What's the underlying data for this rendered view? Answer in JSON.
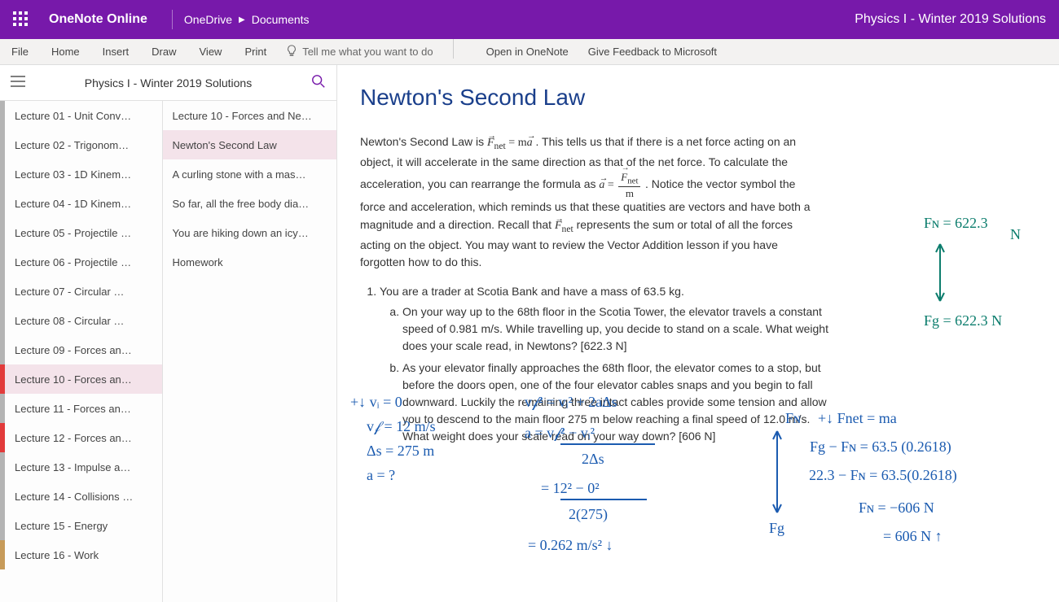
{
  "header": {
    "app_name": "OneNote Online",
    "breadcrumb_root": "OneDrive",
    "breadcrumb_folder": "Documents",
    "doc_title": "Physics I - Winter 2019 Solutions"
  },
  "ribbon": {
    "tabs": [
      "File",
      "Home",
      "Insert",
      "Draw",
      "View",
      "Print"
    ],
    "tell_me": "Tell me what you want to do",
    "open_in": "Open in OneNote",
    "feedback": "Give Feedback to Microsoft"
  },
  "nav": {
    "title": "Physics I - Winter 2019 Solutions",
    "sections": [
      {
        "label": "Lecture 01 - Unit Conv…",
        "color": "#b4b4b4"
      },
      {
        "label": "Lecture 02 - Trigonom…",
        "color": "#b4b4b4"
      },
      {
        "label": "Lecture 03 - 1D Kinem…",
        "color": "#b4b4b4"
      },
      {
        "label": "Lecture 04 - 1D Kinem…",
        "color": "#b4b4b4"
      },
      {
        "label": "Lecture 05 - Projectile …",
        "color": "#b4b4b4"
      },
      {
        "label": "Lecture 06 - Projectile …",
        "color": "#b4b4b4"
      },
      {
        "label": "Lecture 07 - Circular …",
        "color": "#b4b4b4"
      },
      {
        "label": "Lecture 08 - Circular …",
        "color": "#b4b4b4"
      },
      {
        "label": "Lecture 09 - Forces an…",
        "color": "#b4b4b4"
      },
      {
        "label": "Lecture 10 - Forces an…",
        "color": "#e23b3b",
        "selected": true
      },
      {
        "label": "Lecture 11 - Forces an…",
        "color": "#b4b4b4"
      },
      {
        "label": "Lecture 12 - Forces an…",
        "color": "#e23b3b"
      },
      {
        "label": "Lecture 13 - Impulse a…",
        "color": "#b4b4b4"
      },
      {
        "label": "Lecture 14 - Collisions …",
        "color": "#b4b4b4"
      },
      {
        "label": "Lecture 15 - Energy",
        "color": "#b4b4b4"
      },
      {
        "label": "Lecture 16 - Work",
        "color": "#c79b5a"
      }
    ],
    "pages": [
      {
        "label": "Lecture 10 - Forces and Ne…"
      },
      {
        "label": "Newton's Second Law",
        "selected": true
      },
      {
        "label": "A curling stone with a mas…"
      },
      {
        "label": "So far, all the free body dia…"
      },
      {
        "label": "You are hiking down an icy…"
      },
      {
        "label": "Homework"
      }
    ]
  },
  "page": {
    "title": "Newton's Second Law",
    "intro_part1": "Newton's Second Law is ",
    "intro_part2": ". This tells us that if there is a net force acting on an object, it will accelerate in the same direction as that of the net force. To calculate the acceleration, you can rearrange the formula as ",
    "intro_part3": ".  Notice the vector symbol the force and acceleration, which reminds us that these quatities are vectors and have both a magnitude and a direction. Recall that ",
    "intro_part4": " represents the sum or total of all the forces acting on the object. You may want to review the Vector Addition lesson if you have forgotten how to do this.",
    "eq1_lhs": "F⃗",
    "eq1_lhs_sub": "net",
    "eq1_rhs": " = ma⃗",
    "eq2_lhs": "a⃗ = ",
    "eq2_num": "F⃗",
    "eq2_num_sub": "net",
    "eq2_den": "m",
    "fnet_sym": "F⃗",
    "fnet_sub": "net",
    "q1": "You are a trader at Scotia Bank and have a mass of 63.5 kg.",
    "q1a": "On your way up to the 68th floor in the Scotia Tower, the elevator travels a constant speed of 0.981 m/s. While travelling up, you decide to stand on a scale. What weight does your scale read, in Newtons? [622.3 N]",
    "q1b": "As your elevator finally approaches the 68th floor, the elevator comes to a stop, but before the doors open, one of the four elevator cables snaps and you begin to fall downward. Luckily the remaining three intact cables provide some tension and allow you to descend to the main floor 275 m below reaching a final speed of 12.0 m/s. What weight does your scale read on your way down? [606 N]"
  },
  "ink": {
    "top_right": {
      "fn": "Fɴ = 622.3",
      "fn_unit": "N",
      "fg": "Fg = 622.3 N"
    },
    "left_calc": {
      "l1": "+↓ vᵢ = 0",
      "l2": "v𝒻 = 12 m/s",
      "l3": "Δs = 275 m",
      "l4": "a = ?"
    },
    "mid_calc": {
      "l1": "v𝒻² = vᵢ² + 2aΔs",
      "l2": "a = v𝒻² − vᵢ²",
      "l2d": "2Δs",
      "l3": "= 12² − 0²",
      "l3d": "2(275)",
      "l4": "= 0.262 m/s² ↓"
    },
    "right_calc": {
      "l0": "+↓ Fnet = ma",
      "l1": "Fg − Fɴ = 63.5 (0.2618)",
      "l2": "622.3 − Fɴ = 63.5(0.2618)",
      "l3": "Fɴ = −606 N",
      "l4": "= 606 N ↑"
    },
    "fbd2": {
      "fn": "Fɴ",
      "fg": "Fg"
    }
  }
}
